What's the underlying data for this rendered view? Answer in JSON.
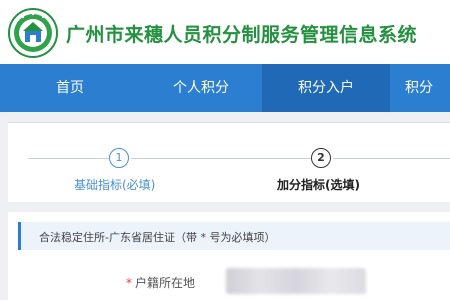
{
  "site": {
    "title": "广州市来穗人员积分制服务管理信息系统"
  },
  "nav": {
    "items": [
      {
        "label": "首页",
        "active": false
      },
      {
        "label": "个人积分",
        "active": false
      },
      {
        "label": "积分入户",
        "active": true
      },
      {
        "label": "积分",
        "active": false
      }
    ]
  },
  "steps": [
    {
      "number": "1",
      "label": "基础指标(必填)",
      "state": "done"
    },
    {
      "number": "2",
      "label": "加分指标(选填)",
      "state": "current"
    }
  ],
  "form": {
    "section_title": "合法稳定住所-广东省居住证（带 * 号为必填项）",
    "fields": [
      {
        "label": "户籍所在地",
        "required_mark": "*",
        "value": ""
      }
    ]
  },
  "colors": {
    "brand_green": "#23913f",
    "nav_blue": "#2c7fd0",
    "nav_active": "#1f69b6",
    "step_done": "#4a90d9",
    "required_red": "#e23c3c"
  }
}
